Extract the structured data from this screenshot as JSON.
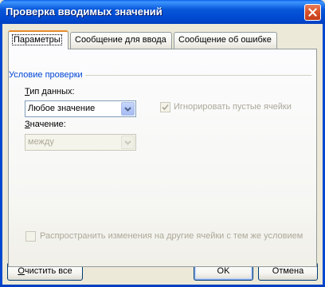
{
  "window": {
    "title": "Проверка вводимых значений",
    "close_icon": "close-icon"
  },
  "tabs": [
    {
      "label": "Параметры",
      "active": true
    },
    {
      "label": "Сообщение для ввода",
      "active": false
    },
    {
      "label": "Сообщение об ошибке",
      "active": false
    }
  ],
  "group": {
    "title": "Условие проверки"
  },
  "data_type": {
    "label_first": "Т",
    "label_rest": "ип данных:",
    "value": "Любое значение"
  },
  "ignore_blank": {
    "label": "Игнорировать пустые ячейки",
    "checked": true,
    "enabled": false
  },
  "value_field": {
    "label_first": "З",
    "label_rest": "начение:",
    "value": "между",
    "enabled": false
  },
  "apply_all": {
    "label": "Распространить изменения на другие ячейки с тем же условием",
    "checked": false,
    "enabled": false
  },
  "buttons": {
    "clear_first": "О",
    "clear_rest": "чистить все",
    "ok": "OK",
    "cancel": "Отмена"
  },
  "colors": {
    "title_bar": "#0054e3",
    "group_title": "#0046d5",
    "active_tab_accent": "#e68b2c"
  }
}
